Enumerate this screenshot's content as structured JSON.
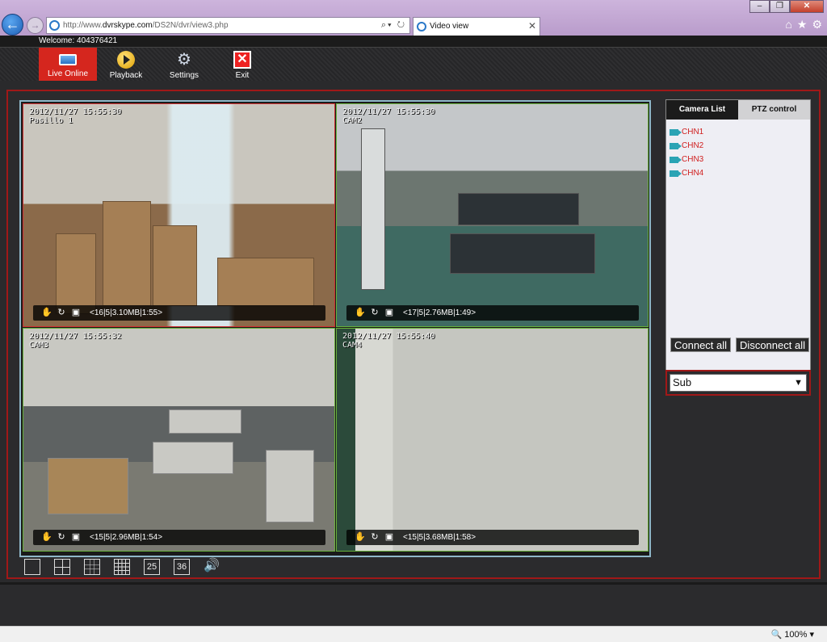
{
  "browser": {
    "url_prefix": "http://www.",
    "url_domain": "dvrskype.com",
    "url_path": "/DS2N/dvr/view3.php",
    "tab_title": "Video view",
    "zoom": "100%"
  },
  "app": {
    "welcome": "Welcome: 404376421",
    "toolbar": {
      "live": "Live Online",
      "playback": "Playback",
      "settings": "Settings",
      "exit": "Exit"
    }
  },
  "cameras": [
    {
      "osd": "2012/11/27 15:55:30\nPasillo 1",
      "stats": "<16|5|3.10MB|1:55>"
    },
    {
      "osd": "2012/11/27 15:55:30\nCAM2",
      "stats": "<17|5|2.76MB|1:49>"
    },
    {
      "osd": "2012/11/27 15:55:32\nCAM3",
      "stats": "<15|5|2.96MB|1:54>"
    },
    {
      "osd": "2012/11/27 15:55:40\nCAM4",
      "stats": "<15|5|3.68MB|1:58>"
    }
  ],
  "layout_buttons": [
    "",
    "",
    "",
    "",
    "25",
    "36",
    "🔊"
  ],
  "side": {
    "tab_camera_list": "Camera List",
    "tab_ptz": "PTZ control",
    "channels": [
      "CHN1",
      "CHN2",
      "CHN3",
      "CHN4"
    ],
    "connect_all": "Connect all",
    "disconnect_all": "Disconnect all",
    "stream": "Sub"
  },
  "colors": {
    "accent": "#d5261e",
    "border": "#a01818",
    "channel_text": "#d02020"
  }
}
